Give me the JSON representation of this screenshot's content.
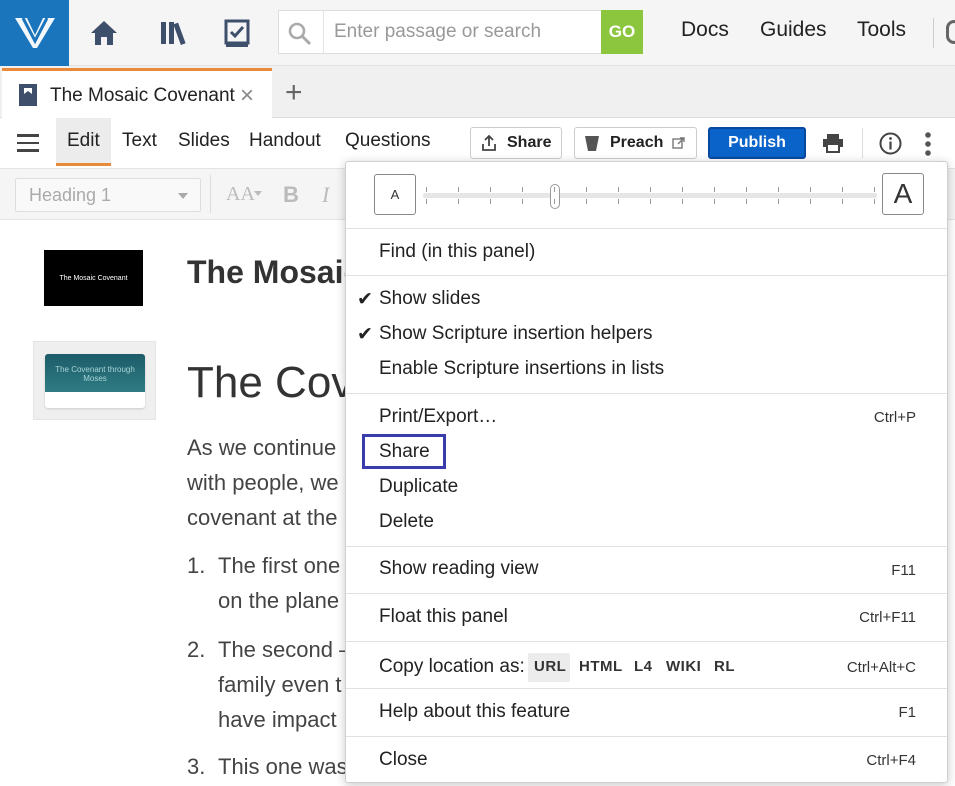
{
  "topbar": {
    "search_placeholder": "Enter passage or search",
    "go_label": "GO",
    "nav": [
      "Docs",
      "Guides",
      "Tools"
    ],
    "accent_blue": "#1b75bc",
    "go_green": "#8cc63f"
  },
  "tab": {
    "title": "The Mosaic Covenant",
    "close": "×",
    "add": "+"
  },
  "panel": {
    "tabs": [
      "Edit",
      "Text",
      "Slides",
      "Handout",
      "Questions"
    ],
    "share_label": "Share",
    "preach_label": "Preach",
    "publish_label": "Publish",
    "publish_color": "#0a63c9",
    "active_tab_underline": "#e98a3a"
  },
  "format": {
    "style_value": "Heading 1",
    "icons": [
      "AA",
      "B",
      "I"
    ]
  },
  "document": {
    "slide1_text": "The Mosaic Covenant",
    "slide2_text": "The Covenant through Moses",
    "title": "The Mosaic Covenant",
    "heading": "The Covenant through Moses",
    "para": [
      "As we continue",
      "with people, we",
      "covenant at the"
    ],
    "list": [
      {
        "num": "1.",
        "lines": [
          "The first one",
          "on the plane"
        ]
      },
      {
        "num": "2.",
        "lines": [
          "The second –",
          "family even t",
          "have impact"
        ]
      },
      {
        "num": "3.",
        "lines": [
          "This one was"
        ]
      }
    ]
  },
  "menu": {
    "font_small": "A",
    "font_large": "A",
    "font_size_level": 0.29,
    "find": "Find (in this panel)",
    "show_slides": "Show slides",
    "show_helpers": "Show Scripture insertion helpers",
    "enable_insertions": "Enable Scripture insertions in lists",
    "check": "✔",
    "print_export": "Print/Export…",
    "print_shortcut": "Ctrl+P",
    "share": "Share",
    "duplicate": "Duplicate",
    "delete": "Delete",
    "reading_view": "Show reading view",
    "reading_shortcut": "F11",
    "float_panel": "Float this panel",
    "float_shortcut": "Ctrl+F11",
    "copy_location": "Copy location as:",
    "copy_formats": [
      "URL",
      "HTML",
      "L4",
      "WIKI",
      "RL"
    ],
    "copy_shortcut": "Ctrl+Alt+C",
    "help": "Help about this feature",
    "help_shortcut": "F1",
    "close": "Close",
    "close_shortcut": "Ctrl+F4",
    "highlight_color": "#3a3cad"
  }
}
